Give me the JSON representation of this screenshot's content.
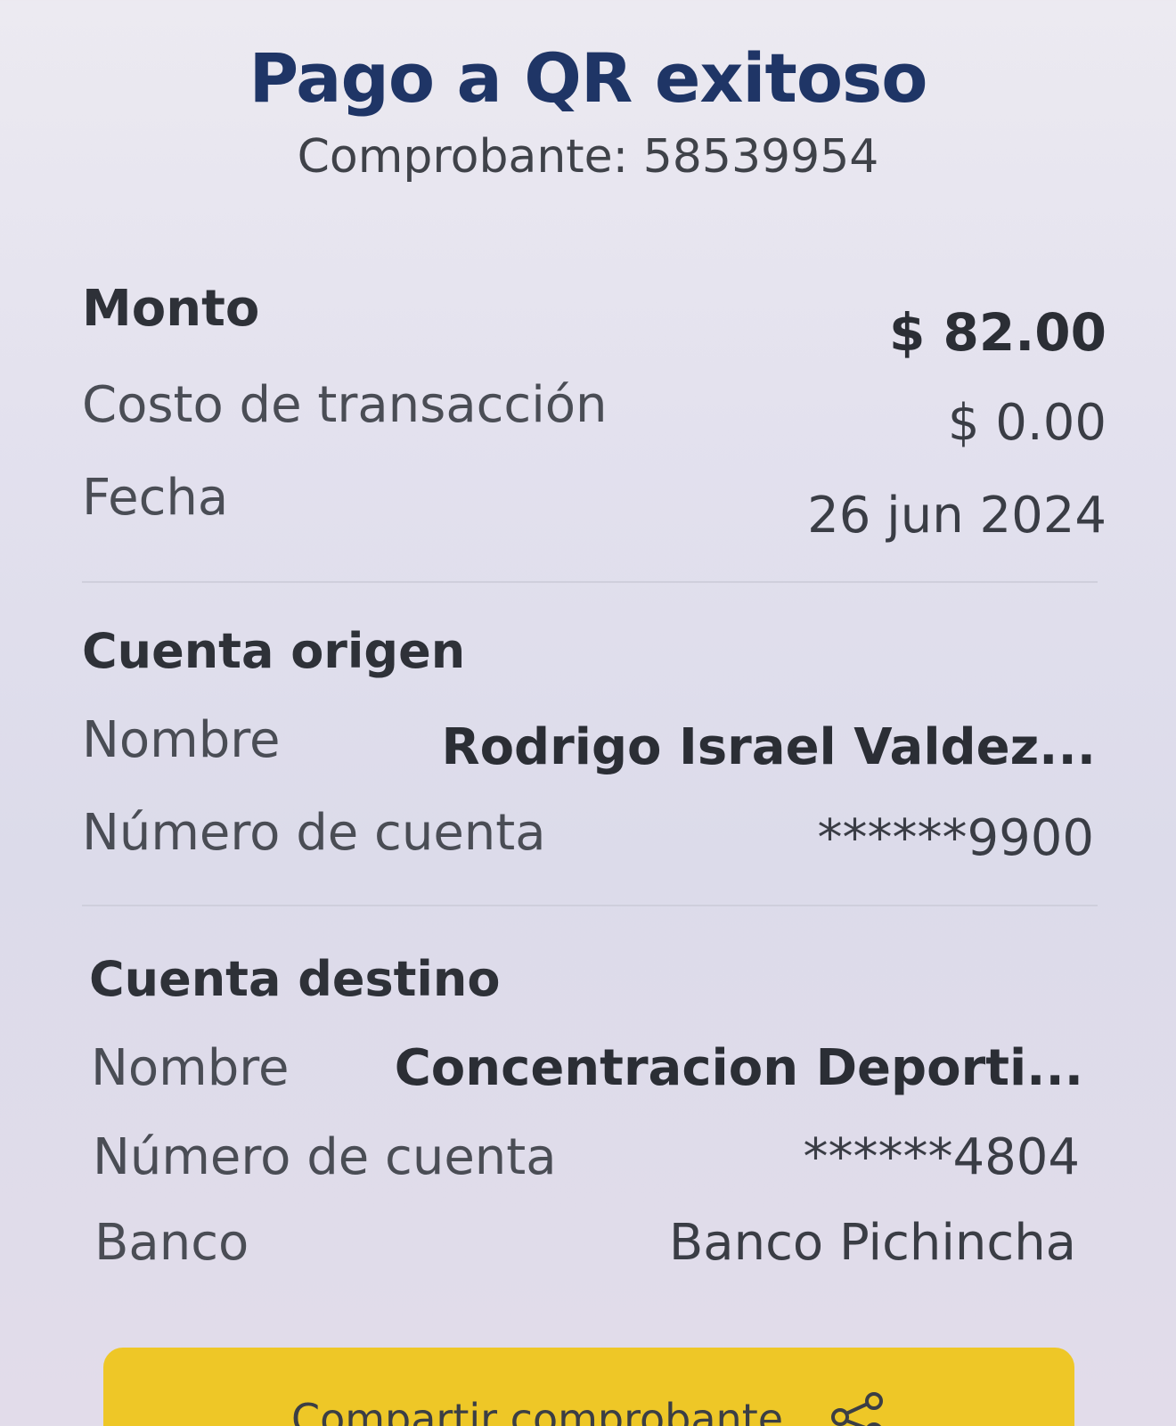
{
  "header": {
    "title": "Pago a QR exitoso",
    "subtitle": "Comprobante: 58539954"
  },
  "summary": {
    "amount_label": "Monto",
    "amount_value": "$ 82.00",
    "fee_label": "Costo de transacción",
    "fee_value": "$ 0.00",
    "date_label": "Fecha",
    "date_value": "26 jun 2024"
  },
  "origin": {
    "title": "Cuenta origen",
    "name_label": "Nombre",
    "name_value": "Rodrigo Israel Valdez...",
    "account_label": "Número de cuenta",
    "account_value": "******9900"
  },
  "destination": {
    "title": "Cuenta destino",
    "name_label": "Nombre",
    "name_value": "Concentracion Deporti...",
    "account_label": "Número de cuenta",
    "account_value": "******4804",
    "bank_label": "Banco",
    "bank_value": "Banco Pichincha"
  },
  "actions": {
    "share_label": "Compartir comprobante",
    "share_icon": "share-icon"
  },
  "colors": {
    "title": "#1f3566",
    "button": "#eec727"
  }
}
